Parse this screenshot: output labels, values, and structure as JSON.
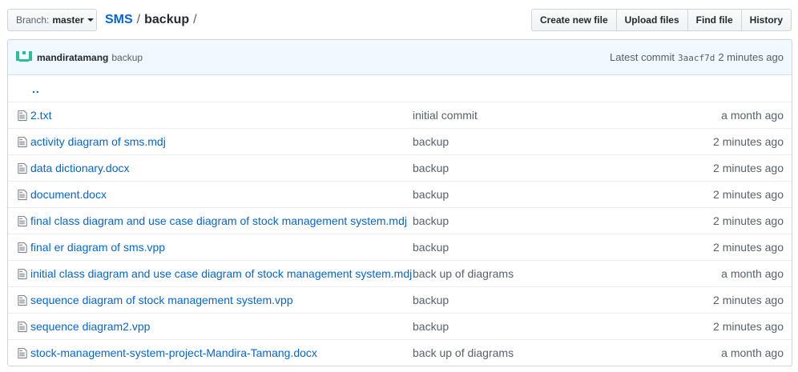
{
  "branch": {
    "prefix": "Branch:",
    "name": "master"
  },
  "breadcrumb": {
    "repo": "SMS",
    "separator": "/",
    "current": "backup",
    "trailing": "/"
  },
  "actions": [
    {
      "label": "Create new file"
    },
    {
      "label": "Upload files"
    },
    {
      "label": "Find file"
    },
    {
      "label": "History"
    }
  ],
  "commit": {
    "author": "mandiratamang",
    "message": "backup",
    "latest_prefix": "Latest commit",
    "sha": "3aacf7d",
    "age": "2 minutes ago",
    "avatar_color": "#2cbe9a"
  },
  "up_link": "..",
  "files": [
    {
      "name": "2.txt",
      "message": "initial commit",
      "age": "a month ago"
    },
    {
      "name": "activity diagram of sms.mdj",
      "message": "backup",
      "age": "2 minutes ago"
    },
    {
      "name": "data dictionary.docx",
      "message": "backup",
      "age": "2 minutes ago"
    },
    {
      "name": "document.docx",
      "message": "backup",
      "age": "2 minutes ago"
    },
    {
      "name": "final class diagram and use case diagram of stock management system.mdj",
      "message": "backup",
      "age": "2 minutes ago"
    },
    {
      "name": "final er diagram of sms.vpp",
      "message": "backup",
      "age": "2 minutes ago"
    },
    {
      "name": "initial class diagram and use case diagram of stock management system.mdj",
      "message": "back up of diagrams",
      "age": "a month ago"
    },
    {
      "name": "sequence diagram of stock management system.vpp",
      "message": "backup",
      "age": "2 minutes ago"
    },
    {
      "name": "sequence diagram2.vpp",
      "message": "backup",
      "age": "2 minutes ago"
    },
    {
      "name": "stock-management-system-project-Mandira-Tamang.docx",
      "message": "back up of diagrams",
      "age": "a month ago"
    }
  ],
  "colors": {
    "link": "#0366d6",
    "muted": "#586069",
    "commit_bar": "#f1f8ff"
  }
}
